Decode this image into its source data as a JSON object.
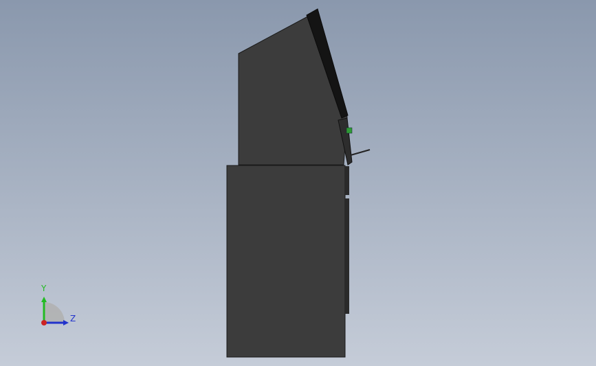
{
  "scene": {
    "background_top": "#8a98ad",
    "background_bottom": "#c5ccd8",
    "body_color": "#3c3c3c",
    "edge_color": "#1a1a1a",
    "screen_color": "#151515"
  },
  "triad": {
    "y_label": "Y",
    "z_label": "Z",
    "y_color": "#22bb22",
    "z_color": "#2233cc",
    "x_color": "#cc2222"
  }
}
